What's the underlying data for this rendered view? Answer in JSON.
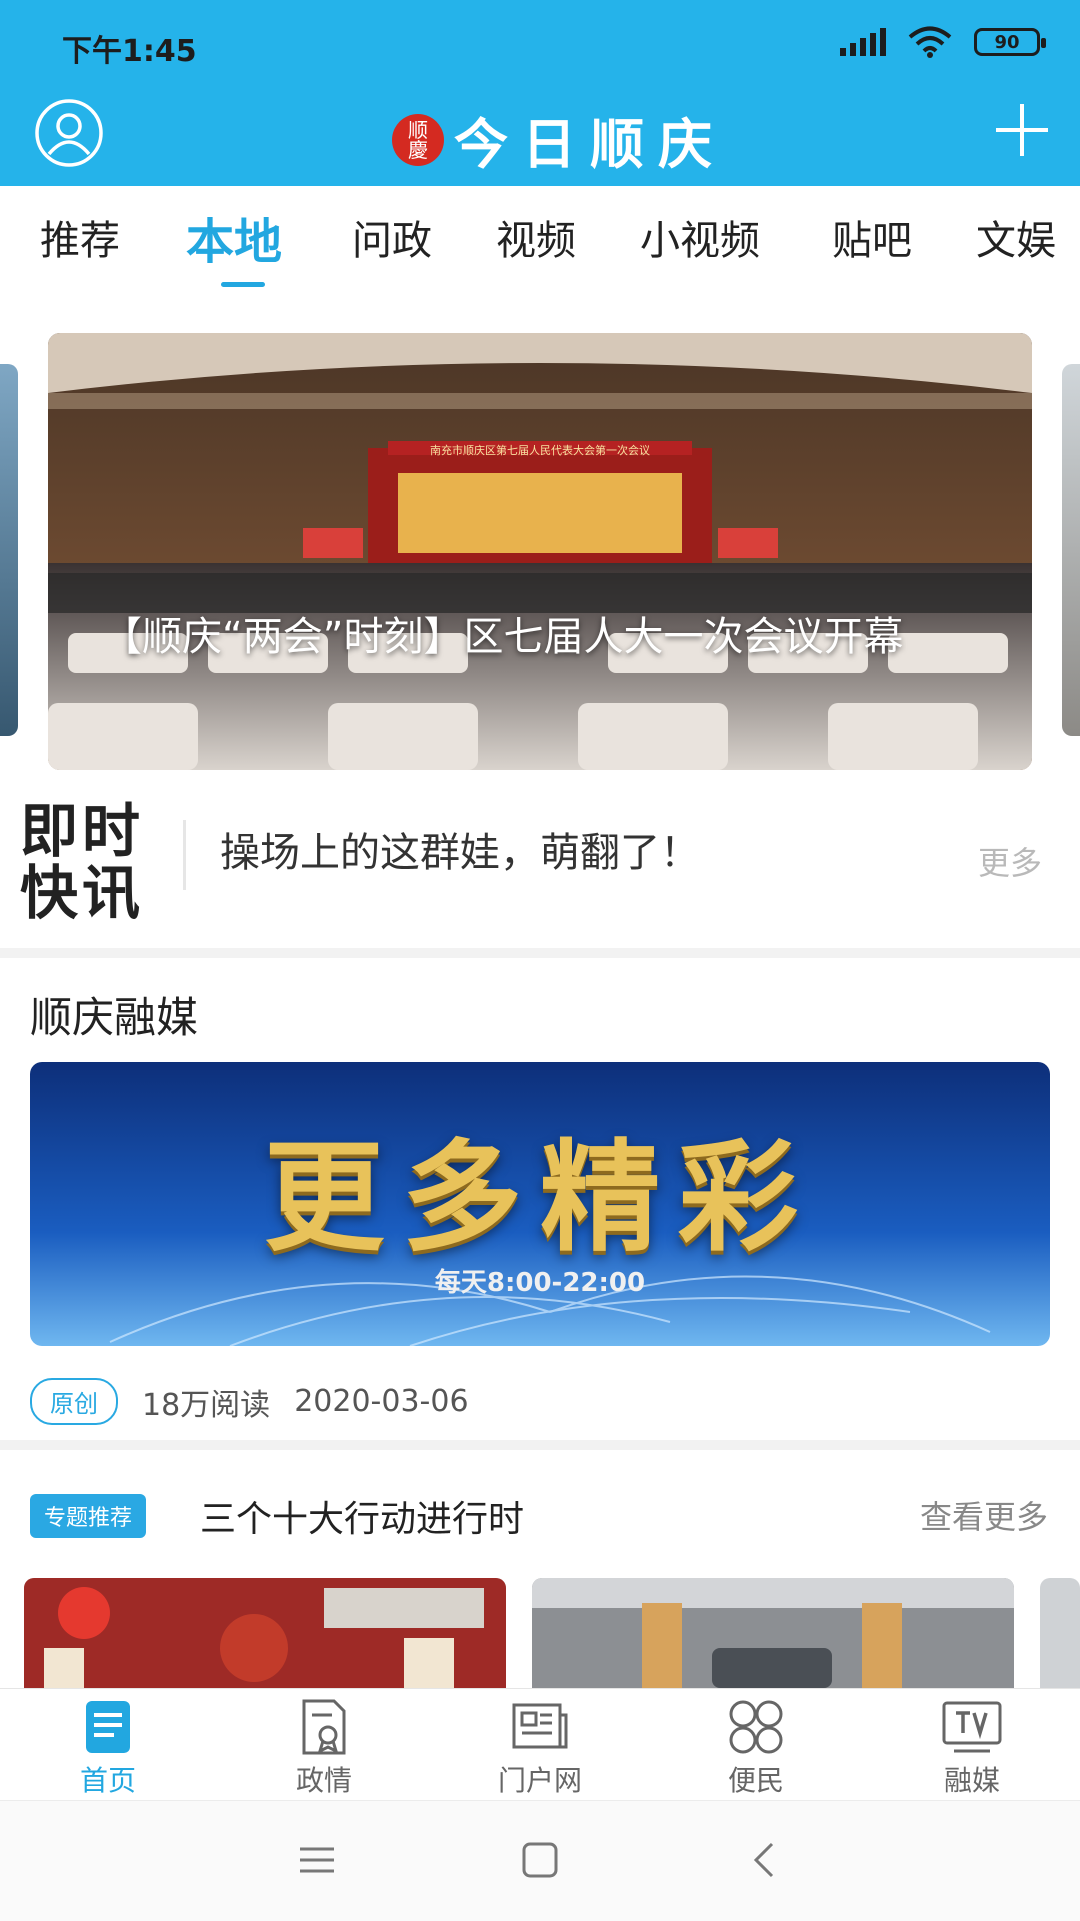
{
  "status_bar": {
    "time": "下午1:45",
    "battery": "90"
  },
  "app_bar": {
    "seal_top": "顺",
    "seal_bottom": "慶",
    "title": "今日顺庆"
  },
  "tabs": [
    {
      "label": "推荐"
    },
    {
      "label": "本地"
    },
    {
      "label": "问政"
    },
    {
      "label": "视频"
    },
    {
      "label": "小视频"
    },
    {
      "label": "贴吧"
    },
    {
      "label": "文娱"
    }
  ],
  "hero": {
    "title": "【顺庆“两会”时刻】区七届人大一次会议开幕",
    "stage_banner": "南充市顺庆区第七届人民代表大会第一次会议"
  },
  "flash_news": {
    "logo_line1": "即时",
    "logo_line2": "快讯",
    "text": "操场上的这群娃，萌翻了！",
    "more": "更多"
  },
  "media": {
    "section_title": "顺庆融媒",
    "banner_headline": "更多精彩",
    "banner_sub": "每天8:00-22:00",
    "tag": "原创",
    "reads": "18万阅读",
    "date": "2020-03-06"
  },
  "topic": {
    "badge": "专题推荐",
    "title": "三个十大行动进行时",
    "more": "查看更多"
  },
  "bottom_nav": [
    {
      "label": "首页",
      "icon": "home-doc-icon"
    },
    {
      "label": "政情",
      "icon": "politics-doc-icon"
    },
    {
      "label": "门户网",
      "icon": "portal-news-icon"
    },
    {
      "label": "便民",
      "icon": "services-grid-icon"
    },
    {
      "label": "融媒",
      "icon": "tv-icon"
    }
  ],
  "colors": {
    "brand": "#25b3ea",
    "accent": "#22a7e0",
    "seal": "#d42a21",
    "banner_gold": "#e8c25a"
  }
}
